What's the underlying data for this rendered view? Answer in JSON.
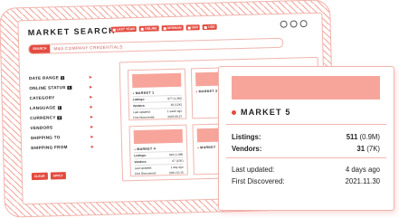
{
  "app": {
    "title": "MARKET SEARCH"
  },
  "chips": [
    "LAST YEAR",
    "ONLINE",
    "GERMAN",
    "USD",
    "USD"
  ],
  "search": {
    "button": "SEARCH",
    "value": "M&A COMPANY CREDENTIALS"
  },
  "filters": [
    {
      "label": "DATE RANGE",
      "count": "1"
    },
    {
      "label": "ONLINE STATUS",
      "count": "1"
    },
    {
      "label": "CATEGORY",
      "count": ""
    },
    {
      "label": "LANGUAGE",
      "count": "1"
    },
    {
      "label": "CURRENCY",
      "count": "2"
    },
    {
      "label": "VENDORS",
      "count": ""
    },
    {
      "label": "SHIPPING TO",
      "count": ""
    },
    {
      "label": "SHIPPING FROM",
      "count": ""
    }
  ],
  "filter_actions": {
    "clear": "CLEAR",
    "apply": "APPLY"
  },
  "mini_cards": [
    {
      "name": "MARKET 1",
      "listings": "877 (1.2M)",
      "vendors": "62 (12K)",
      "updated": "1 week ago",
      "discovered": "2022.08.27"
    },
    {
      "name": "MARKET 2",
      "listings": "",
      "vendors": "",
      "updated": "",
      "discovered": ""
    },
    {
      "name": "MARKET 4",
      "listings": "924 (1.4M)",
      "vendors": "67 (15K)",
      "updated": "1 day ago",
      "discovered": "2021.10.15"
    },
    {
      "name": "MARKET",
      "listings": "",
      "vendors": "",
      "updated": "",
      "discovered": ""
    }
  ],
  "mini_labels": {
    "listings": "Listings:",
    "vendors": "Vendors:",
    "updated": "Last updated:",
    "discovered": "First Discovered:"
  },
  "detail": {
    "name": "MARKET 5",
    "listings_label": "Listings:",
    "listings_value": "511",
    "listings_extra": "(0.9M)",
    "vendors_label": "Vendors:",
    "vendors_value": "31",
    "vendors_extra": "(7K)",
    "updated_label": "Last updated:",
    "updated_value": "4 days ago",
    "discovered_label": "First Discovered:",
    "discovered_value": "2021.11.30"
  },
  "colors": {
    "accent": "#e34b3f",
    "accent_light": "#f7a59b",
    "border": "#f0b5ae"
  }
}
